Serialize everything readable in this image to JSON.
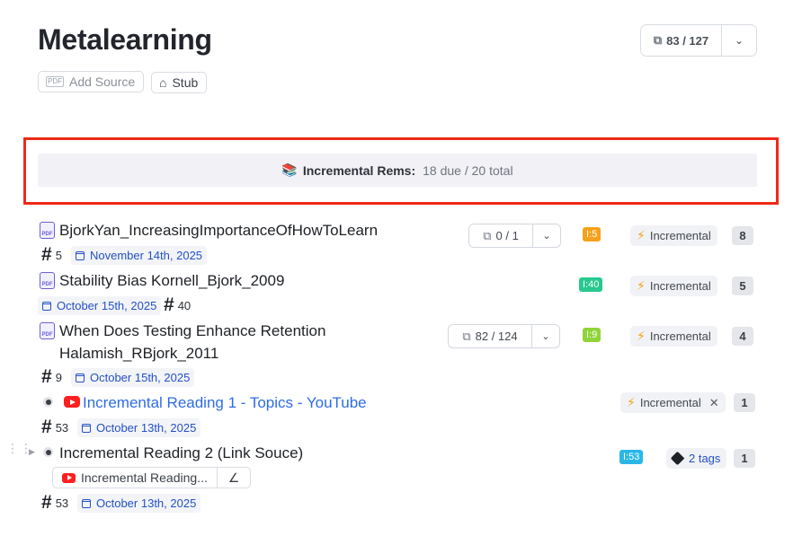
{
  "page": {
    "title": "Metalearning"
  },
  "header": {
    "flashcards": {
      "value": "83 / 127",
      "icon": "cards-icon"
    },
    "add_source_label": "Add Source",
    "stub_label": "Stub"
  },
  "incremental_rems": {
    "emoji": "📚",
    "label": "Incremental Rems:",
    "count": "18 due / 20 total"
  },
  "rows": [
    {
      "title": "BjorkYan_IncreasingImportanceOfHowToLearn",
      "hash": "5",
      "date": "November 14th, 2025",
      "cards": "0 / 1",
      "interval": "I:5",
      "interval_color": "#f5a21b",
      "tag": "Incremental",
      "count": "8"
    },
    {
      "title": "Stability Bias Kornell_Bjork_2009",
      "hash": "40",
      "date": "October 15th, 2025",
      "interval": "I:40",
      "interval_color": "#27c98f",
      "tag": "Incremental",
      "count": "5"
    },
    {
      "title_line1": "When Does Testing Enhance Retention",
      "title_line2": "Halamish_RBjork_2011",
      "hash": "9",
      "date": "October 15th, 2025",
      "cards": "82 / 124",
      "interval": "I:9",
      "interval_color": "#8fd43a",
      "tag": "Incremental",
      "count": "4"
    },
    {
      "title": "Incremental Reading 1 - Topics - YouTube",
      "hash": "53",
      "date": "October 13th, 2025",
      "tag": "Incremental",
      "count": "1"
    },
    {
      "title": "Incremental Reading 2 (Link Souce)",
      "source_link": "Incremental Reading...",
      "hash": "53",
      "date": "October 13th, 2025",
      "interval": "I:53",
      "interval_color": "#2ab7e6",
      "tags": "2 tags",
      "count": "1"
    }
  ]
}
